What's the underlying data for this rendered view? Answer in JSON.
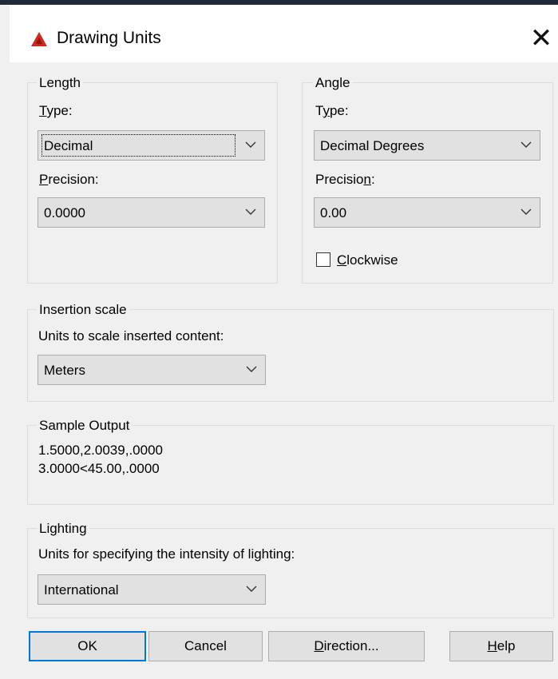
{
  "window": {
    "title": "Drawing Units",
    "close_glyph": "✕"
  },
  "length": {
    "legend": "Length",
    "type_label_u": "T",
    "type_label_rest": "ype:",
    "type_value": "Decimal",
    "precision_label_u": "P",
    "precision_label_rest": "recision:",
    "precision_value": "0.0000"
  },
  "angle": {
    "legend": "Angle",
    "type_label_pre": "T",
    "type_label_u": "y",
    "type_label_rest": "pe:",
    "type_value": "Decimal Degrees",
    "precision_label_pre": "Precisio",
    "precision_label_u": "n",
    "precision_label_rest": ":",
    "precision_value": "0.00",
    "clockwise_u": "C",
    "clockwise_rest": "lockwise",
    "clockwise_checked": false
  },
  "insertion": {
    "legend": "Insertion scale",
    "label": "Units to scale inserted content:",
    "value": "Meters"
  },
  "sample": {
    "legend": "Sample Output",
    "line1": "1.5000,2.0039,.0000",
    "line2": "3.0000<45.00,.0000"
  },
  "lighting": {
    "legend": "Lighting",
    "label": "Units for specifying the intensity of lighting:",
    "value": "International"
  },
  "buttons": {
    "ok": "OK",
    "cancel": "Cancel",
    "direction_u": "D",
    "direction_rest": "irection...",
    "help_u": "H",
    "help_rest": "elp"
  },
  "colors": {
    "app_icon": "#d1271f",
    "default_button_border": "#0078d7"
  }
}
